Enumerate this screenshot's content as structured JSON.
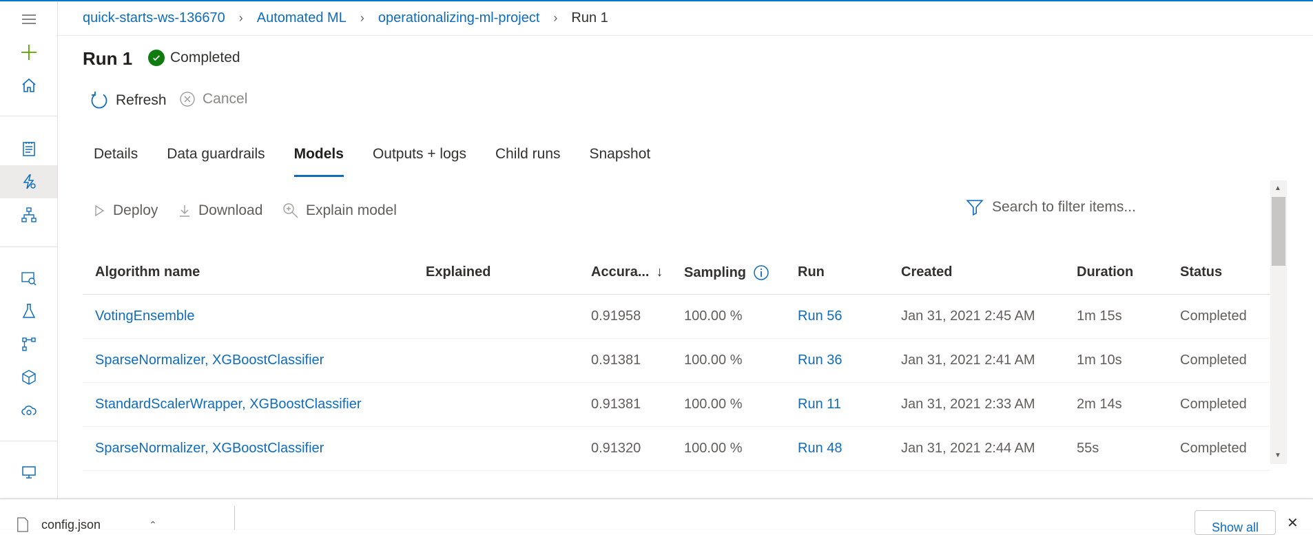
{
  "breadcrumb": {
    "items": [
      "quick-starts-ws-136670",
      "Automated ML",
      "operationalizing-ml-project"
    ],
    "current": "Run 1"
  },
  "header": {
    "title": "Run 1",
    "status": "Completed"
  },
  "commands": {
    "refresh": "Refresh",
    "cancel": "Cancel"
  },
  "tabs": [
    "Details",
    "Data guardrails",
    "Models",
    "Outputs + logs",
    "Child runs",
    "Snapshot"
  ],
  "active_tab": "Models",
  "toolbar": {
    "deploy": "Deploy",
    "download": "Download",
    "explain": "Explain model",
    "search_placeholder": "Search to filter items..."
  },
  "table": {
    "columns": [
      "Algorithm name",
      "Explained",
      "Accura...",
      "Sampling",
      "Run",
      "Created",
      "Duration",
      "Status"
    ],
    "sort_indicator": "↓",
    "rows": [
      {
        "algorithm": "VotingEnsemble",
        "explained": "",
        "accuracy": "0.91958",
        "sampling": "100.00 %",
        "run": "Run 56",
        "created": "Jan 31, 2021 2:45 AM",
        "duration": "1m 15s",
        "status": "Completed"
      },
      {
        "algorithm": "SparseNormalizer, XGBoostClassifier",
        "explained": "",
        "accuracy": "0.91381",
        "sampling": "100.00 %",
        "run": "Run 36",
        "created": "Jan 31, 2021 2:41 AM",
        "duration": "1m 10s",
        "status": "Completed"
      },
      {
        "algorithm": "StandardScalerWrapper, XGBoostClassifier",
        "explained": "",
        "accuracy": "0.91381",
        "sampling": "100.00 %",
        "run": "Run 11",
        "created": "Jan 31, 2021 2:33 AM",
        "duration": "2m 14s",
        "status": "Completed"
      },
      {
        "algorithm": "SparseNormalizer, XGBoostClassifier",
        "explained": "",
        "accuracy": "0.91320",
        "sampling": "100.00 %",
        "run": "Run 48",
        "created": "Jan 31, 2021 2:44 AM",
        "duration": "55s",
        "status": "Completed"
      }
    ]
  },
  "download_bar": {
    "file": "config.json",
    "show_all": "Show all"
  },
  "colors": {
    "accent": "#0f6cbd",
    "success": "#107c10",
    "plus": "#57a300"
  }
}
